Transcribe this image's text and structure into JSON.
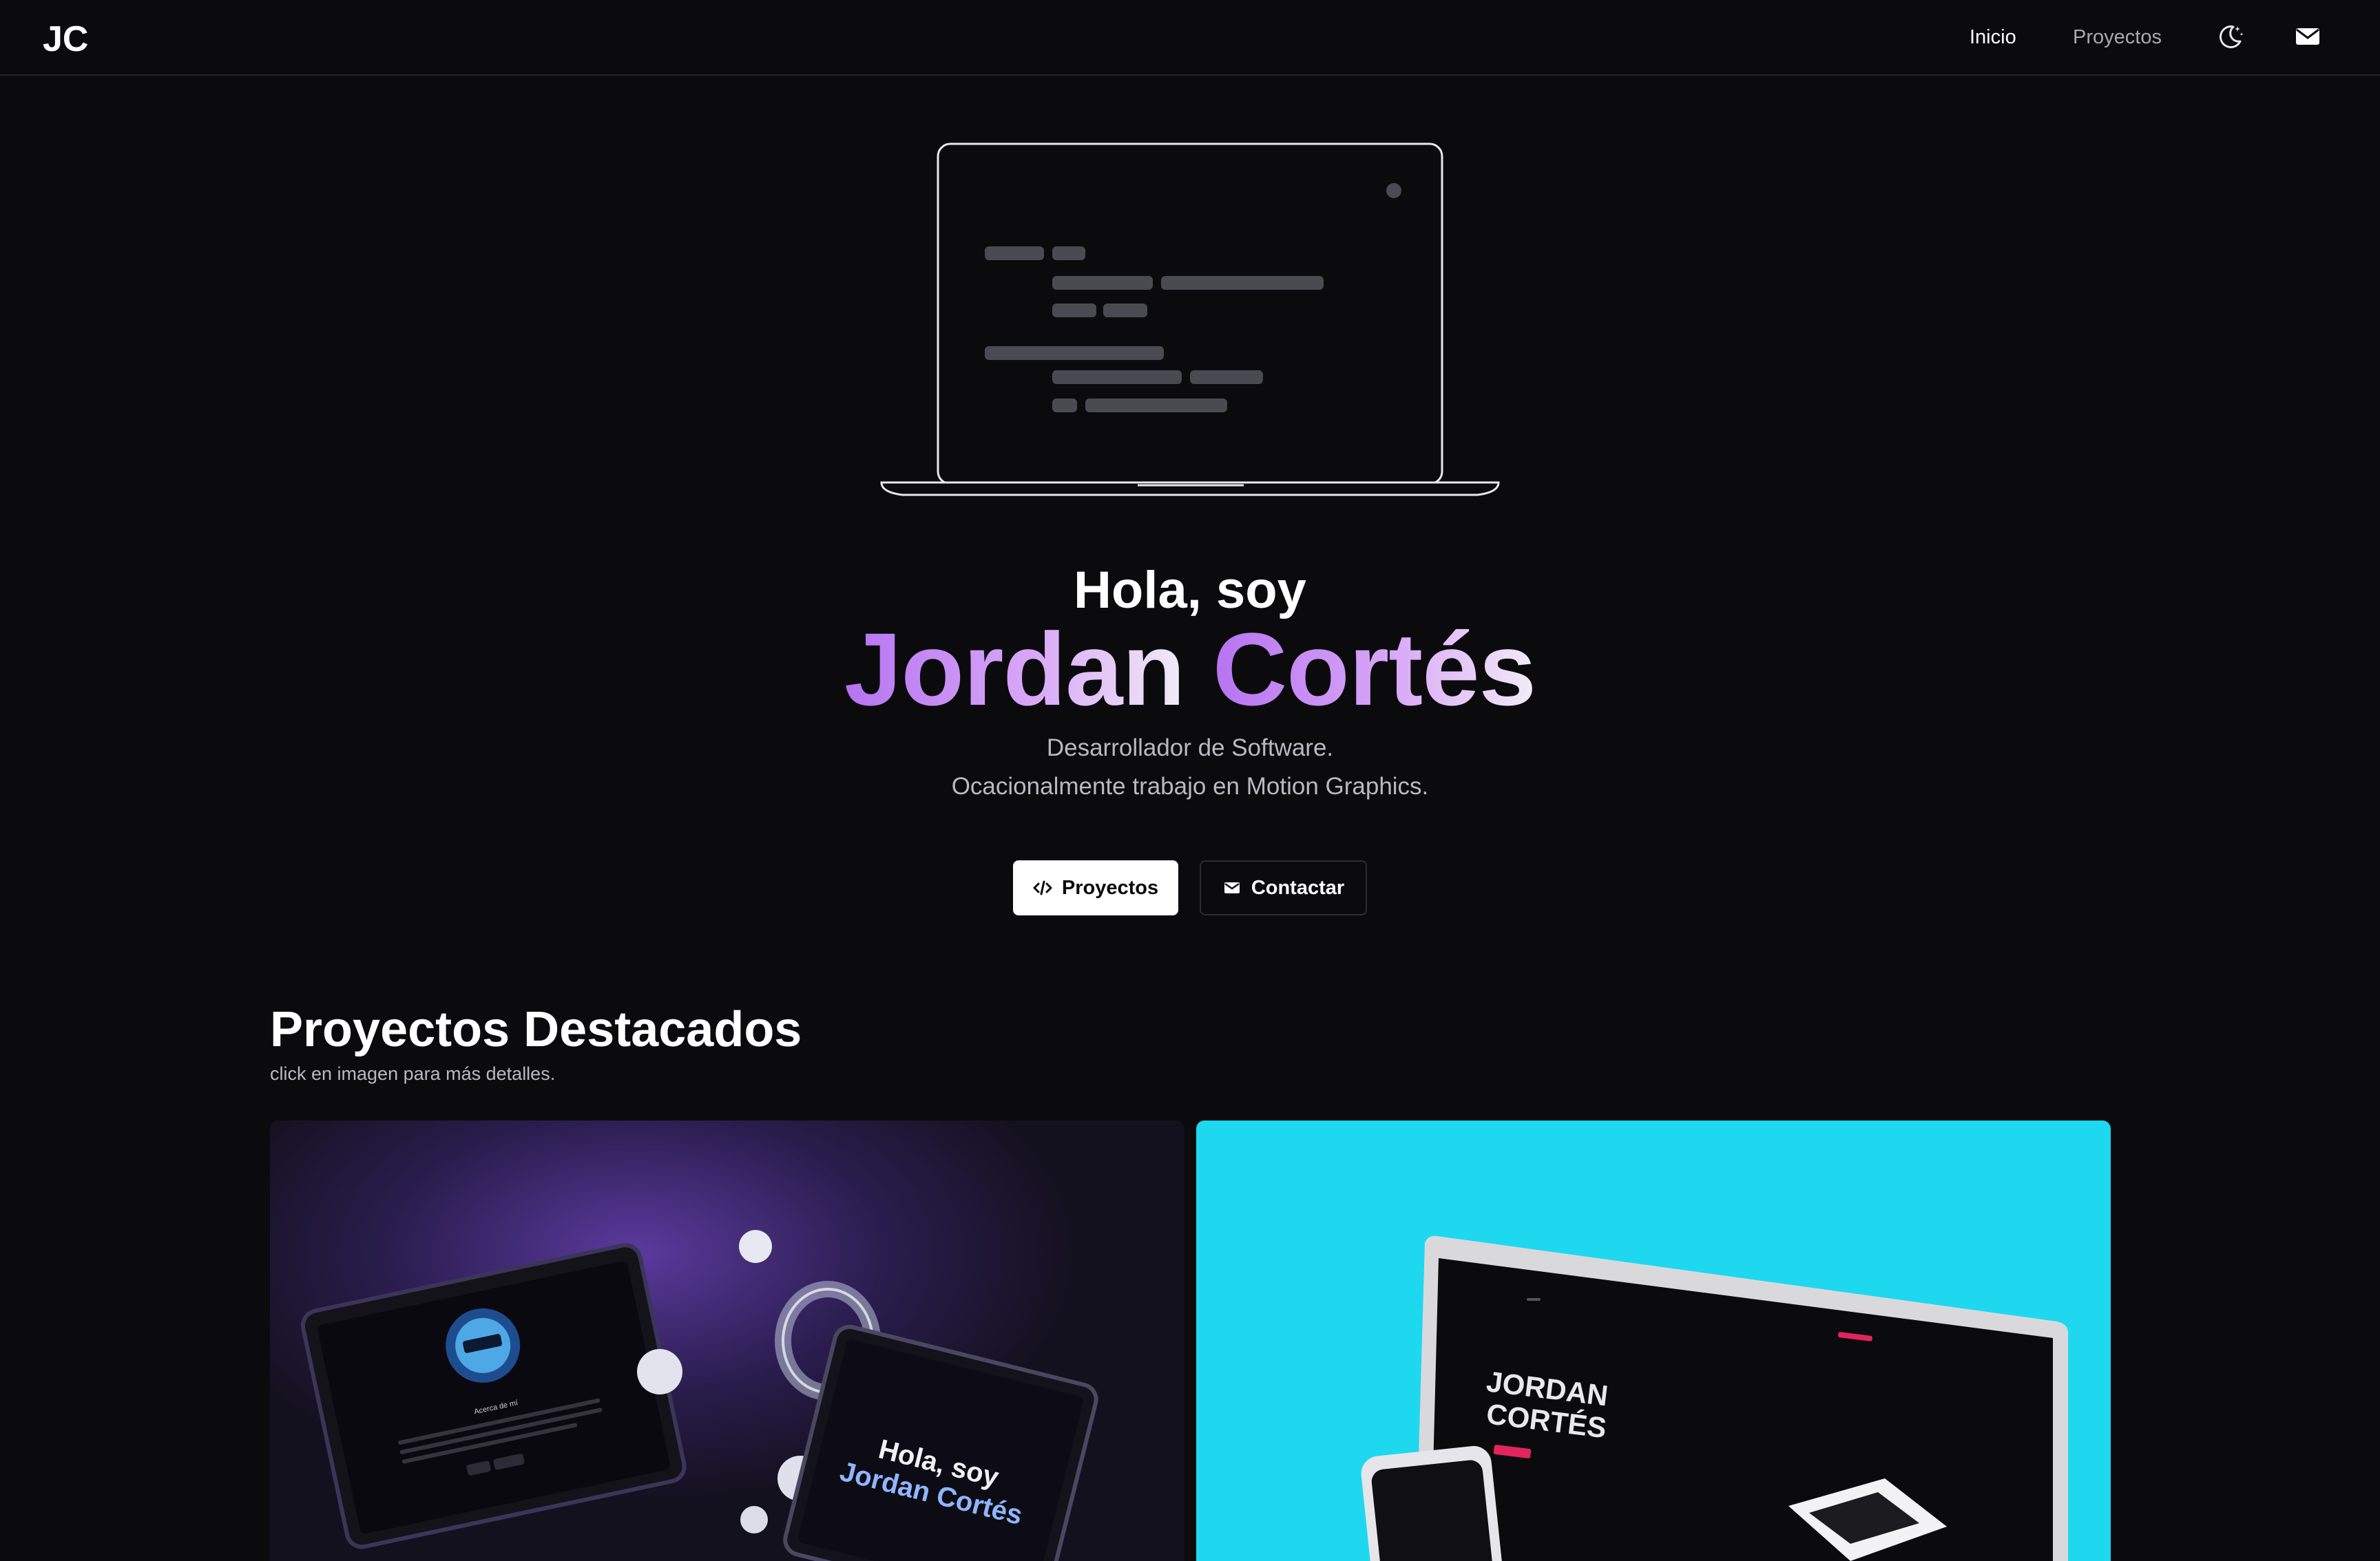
{
  "nav": {
    "logo_text": "JC",
    "links": [
      {
        "label": "Inicio",
        "active": true
      },
      {
        "label": "Proyectos",
        "active": false
      }
    ],
    "theme_icon": "moon-stars-icon",
    "mail_icon": "mail-icon"
  },
  "hero": {
    "greeting": "Hola, soy",
    "name_first": "Jordan",
    "name_last": "Cortés",
    "subtitle_line1": "Desarrollador de Software.",
    "subtitle_line2": "Ocacionalmente trabajo en Motion Graphics.",
    "buttons": {
      "projects_label": "Proyectos",
      "projects_icon": "code-icon",
      "contact_label": "Contactar",
      "contact_icon": "mail-icon"
    }
  },
  "featured": {
    "title": "Proyectos Destacados",
    "subtitle": "click en imagen para más detalles.",
    "cards": [
      {
        "label_about": "Acerca de mí",
        "hero_text_1": "Hola, soy",
        "hero_text_2": "Jordan Cortés"
      },
      {
        "hero_text_1": "JORDAN",
        "hero_text_2": "CORTÉS"
      }
    ]
  },
  "colors": {
    "background": "#0b0b0e",
    "accent_purple": "#b673f0",
    "card2_bg": "#1ed8ef"
  }
}
